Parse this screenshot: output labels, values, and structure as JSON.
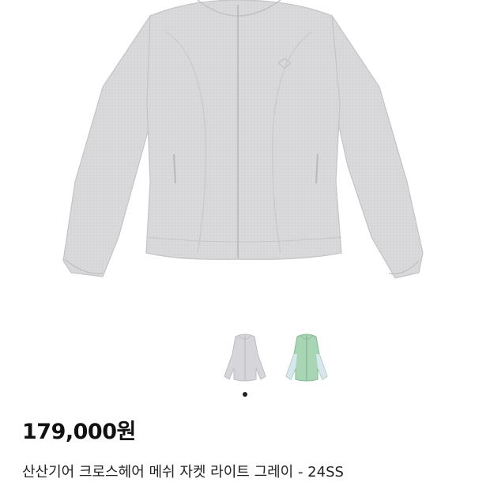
{
  "product": {
    "price": "179,000원",
    "title": "산산기어 크로스헤어 메쉬 자켓 라이트 그레이 - 24SS"
  },
  "gallery": {
    "main_image": "gray-mesh-jacket-photo",
    "thumbnails": [
      {
        "name": "light-gray-jacket-thumbnail",
        "color": "#d4d4d8"
      },
      {
        "name": "mint-green-jacket-thumbnail",
        "color": "#9fcfae"
      }
    ],
    "active_index": 0
  },
  "colors": {
    "jacket_gray": "#d7d7da",
    "jacket_mint": "#a5d4b2",
    "dot_active": "#222222"
  }
}
